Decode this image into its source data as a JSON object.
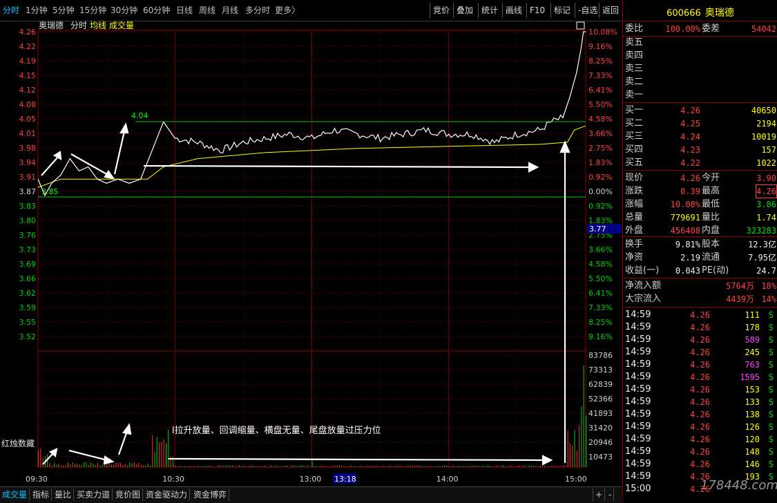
{
  "toolbar": {
    "periods": [
      "分时",
      "1分钟",
      "5分钟",
      "15分钟",
      "30分钟",
      "60分钟",
      "日线",
      "周线",
      "月线",
      "多分时",
      "更多〉"
    ],
    "buttons": [
      "竞价",
      "叠加",
      "统计",
      "画线",
      "F10",
      "标记",
      "-自选",
      "返回"
    ]
  },
  "chart": {
    "stock_name": "奥瑞德",
    "mode_label": "分时",
    "avg_label": "均线",
    "vol_label": "成交量",
    "annotation": "l拉升放量、回调缩量、横盘无量、尾盘放量过压力位",
    "peak_label": "4.04",
    "low_label": "3.85",
    "cursor_price": "3.77",
    "cursor_time": "13:18",
    "vol_panel_label": "红烛数藏",
    "colors": {
      "price": "#ffffff",
      "avg": "#ffff00",
      "grid": "#7a0000",
      "up": "#ff3030",
      "down": "#00d000"
    }
  },
  "chart_data": {
    "type": "line",
    "price_ticks": [
      "4.26",
      "4.22",
      "4.19",
      "4.15",
      "4.12",
      "4.08",
      "4.05",
      "4.01",
      "3.98",
      "3.94",
      "3.91",
      "3.87",
      "3.83",
      "3.80",
      "3.76",
      "3.73",
      "3.69",
      "3.66",
      "3.62",
      "3.59",
      "3.55",
      "3.52"
    ],
    "pct_ticks": [
      "10.08%",
      "9.16%",
      "8.25%",
      "7.33%",
      "6.41%",
      "5.50%",
      "4.58%",
      "3.66%",
      "2.75%",
      "1.83%",
      "0.92%",
      "0.00%",
      "0.92%",
      "1.83%",
      "2.75%",
      "3.66%",
      "4.58%",
      "5.50%",
      "6.41%",
      "7.33%",
      "8.25%",
      "9.16%"
    ],
    "vol_ticks": [
      "83786",
      "73313",
      "62839",
      "52366",
      "41893",
      "31420",
      "20946",
      "10473"
    ],
    "time_ticks": [
      "09:30",
      "10:30",
      "13:00",
      "14:00",
      "15:00"
    ],
    "ylim": [
      3.48,
      4.26
    ],
    "prev_close": 3.87,
    "series": [
      {
        "t": [
          0,
          3,
          6,
          10,
          14,
          18,
          22,
          26,
          30,
          35,
          40,
          45,
          50,
          55,
          60,
          70,
          80,
          90,
          100,
          110,
          120,
          130,
          140,
          150,
          160,
          170,
          180,
          190,
          200,
          210,
          220,
          225,
          230,
          233,
          236,
          238,
          239,
          240
        ],
        "v": [
          3.9,
          3.86,
          3.89,
          3.91,
          3.95,
          3.92,
          3.93,
          3.9,
          3.89,
          3.9,
          3.89,
          3.9,
          3.97,
          4.04,
          4.0,
          3.99,
          3.97,
          3.99,
          4.0,
          4.01,
          4.0,
          4.02,
          4.01,
          4.0,
          4.01,
          4.02,
          4.01,
          4.01,
          3.99,
          4.01,
          4.02,
          4.04,
          4.05,
          4.1,
          4.16,
          4.22,
          4.26,
          4.26
        ]
      },
      {
        "t": [
          0,
          10,
          30,
          48,
          55,
          70,
          100,
          140,
          180,
          220,
          232,
          235,
          240
        ],
        "v": [
          3.88,
          3.9,
          3.9,
          3.9,
          3.93,
          3.95,
          3.965,
          3.975,
          3.98,
          3.985,
          3.99,
          4.02,
          4.03
        ]
      }
    ],
    "volume_max": 83786
  },
  "side": {
    "code": "600666",
    "name": "奥瑞德",
    "weibi_label": "委比",
    "weibi": "100.00%",
    "weicha_label": "委差",
    "weicha": "54042",
    "asks": [
      {
        "label": "卖五"
      },
      {
        "label": "卖四"
      },
      {
        "label": "卖三"
      },
      {
        "label": "卖二"
      },
      {
        "label": "卖一"
      }
    ],
    "bids": [
      {
        "label": "买一",
        "price": "4.26",
        "vol": "40650"
      },
      {
        "label": "买二",
        "price": "4.25",
        "vol": "2194"
      },
      {
        "label": "买三",
        "price": "4.24",
        "vol": "10019"
      },
      {
        "label": "买四",
        "price": "4.23",
        "vol": "157"
      },
      {
        "label": "买五",
        "price": "4.22",
        "vol": "1022"
      }
    ],
    "quote": [
      {
        "l1": "现价",
        "v1": "4.26",
        "c1": "red",
        "l2": "今开",
        "v2": "3.90",
        "c2": "red"
      },
      {
        "l1": "涨跌",
        "v1": "0.39",
        "c1": "red",
        "l2": "最高",
        "v2": "4.26",
        "c2": "red"
      },
      {
        "l1": "涨幅",
        "v1": "10.08%",
        "c1": "red",
        "l2": "最低",
        "v2": "3.86",
        "c2": "green"
      },
      {
        "l1": "总量",
        "v1": "779691",
        "c1": "yellow",
        "l2": "量比",
        "v2": "1.74",
        "c2": "yellow"
      },
      {
        "l1": "外盘",
        "v1": "456408",
        "c1": "red",
        "l2": "内盘",
        "v2": "323283",
        "c2": "green"
      }
    ],
    "fund": [
      {
        "l1": "换手",
        "v1": "9.81%",
        "l2": "股本",
        "v2": "12.3亿"
      },
      {
        "l1": "净资",
        "v1": "2.19",
        "l2": "流通",
        "v2": "7.95亿"
      },
      {
        "l1": "收益(一)",
        "v1": "0.043",
        "l2": "PE(动)",
        "v2": "24.7"
      }
    ],
    "flow": [
      {
        "label": "净流入额",
        "amount": "5764万",
        "pct": "18%"
      },
      {
        "label": "大宗流入",
        "amount": "4439万",
        "pct": "14%"
      }
    ],
    "ticks": [
      {
        "t": "14:59",
        "p": "4.26",
        "v": "111",
        "c": "yellow"
      },
      {
        "t": "14:59",
        "p": "4.26",
        "v": "178",
        "c": "yellow"
      },
      {
        "t": "14:59",
        "p": "4.26",
        "v": "589",
        "c": "magenta"
      },
      {
        "t": "14:59",
        "p": "4.26",
        "v": "245",
        "c": "yellow"
      },
      {
        "t": "14:59",
        "p": "4.26",
        "v": "763",
        "c": "magenta"
      },
      {
        "t": "14:59",
        "p": "4.26",
        "v": "1595",
        "c": "magenta"
      },
      {
        "t": "14:59",
        "p": "4.26",
        "v": "153",
        "c": "yellow"
      },
      {
        "t": "14:59",
        "p": "4.26",
        "v": "133",
        "c": "yellow"
      },
      {
        "t": "14:59",
        "p": "4.26",
        "v": "138",
        "c": "yellow"
      },
      {
        "t": "14:59",
        "p": "4.26",
        "v": "126",
        "c": "yellow"
      },
      {
        "t": "14:59",
        "p": "4.26",
        "v": "120",
        "c": "yellow"
      },
      {
        "t": "14:59",
        "p": "4.26",
        "v": "148",
        "c": "yellow"
      },
      {
        "t": "14:59",
        "p": "4.26",
        "v": "146",
        "c": "yellow"
      },
      {
        "t": "14:59",
        "p": "4.26",
        "v": "193",
        "c": "yellow"
      },
      {
        "t": "15:00",
        "p": "4.26",
        "v": "",
        "c": "yellow"
      }
    ],
    "tick_side": "S"
  },
  "tabs": [
    "成交量",
    "指标",
    "量比",
    "买卖力道",
    "竞价图",
    "资金驱动力",
    "资金博弈"
  ],
  "watermark": "178448.com"
}
